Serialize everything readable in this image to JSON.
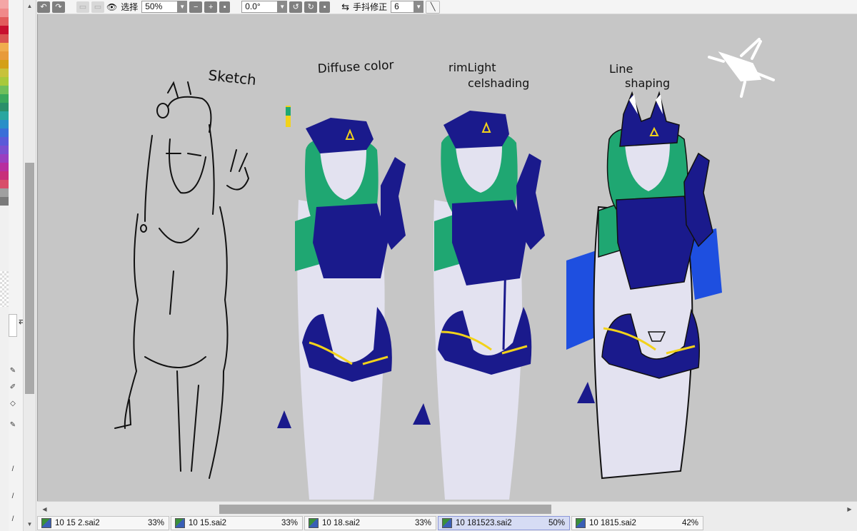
{
  "toolbar": {
    "view_label": "选择",
    "zoom_value": "50%",
    "rotation_value": "0.0°",
    "stabilizer_label": "手抖修正",
    "stabilizer_value": "6"
  },
  "canvas": {
    "labels": {
      "sketch": "Sketch",
      "diffuse": "Diffuse color",
      "rim_line1": "rimLight",
      "rim_line2": "celshading",
      "line_line1": "Line",
      "line_line2": "shaping"
    }
  },
  "tabs": [
    {
      "name": "10 15 2.sai2",
      "zoom": "33%",
      "active": false
    },
    {
      "name": "10 15.sai2",
      "zoom": "33%",
      "active": false
    },
    {
      "name": "10 18.sai2",
      "zoom": "33%",
      "active": false
    },
    {
      "name": "10 181523.sai2",
      "zoom": "50%",
      "active": true
    },
    {
      "name": "10 1815.sai2",
      "zoom": "42%",
      "active": false
    }
  ],
  "palette_colors": [
    "#f4a6a6",
    "#f08a8a",
    "#e25c5c",
    "#c8102e",
    "#d9534f",
    "#f0ad4e",
    "#e89b3b",
    "#d4a017",
    "#c8c23a",
    "#a8c93a",
    "#6fbf5a",
    "#3aa85c",
    "#2a8f6a",
    "#2aa6a0",
    "#2a8fc8",
    "#3a6fd8",
    "#5a5ad8",
    "#7a4fd0",
    "#9a3fc0",
    "#b82f9f",
    "#c82f7a",
    "#d84f6a",
    "#a0a0a0",
    "#7a7a7a"
  ],
  "colors": {
    "canvas_bg": "#c6c6c6",
    "navy": "#1a1a8c",
    "green": "#1fa772",
    "skin": "#e3e2f0",
    "accent_yellow": "#f2d21a",
    "blue_accent": "#1e4fe0"
  }
}
